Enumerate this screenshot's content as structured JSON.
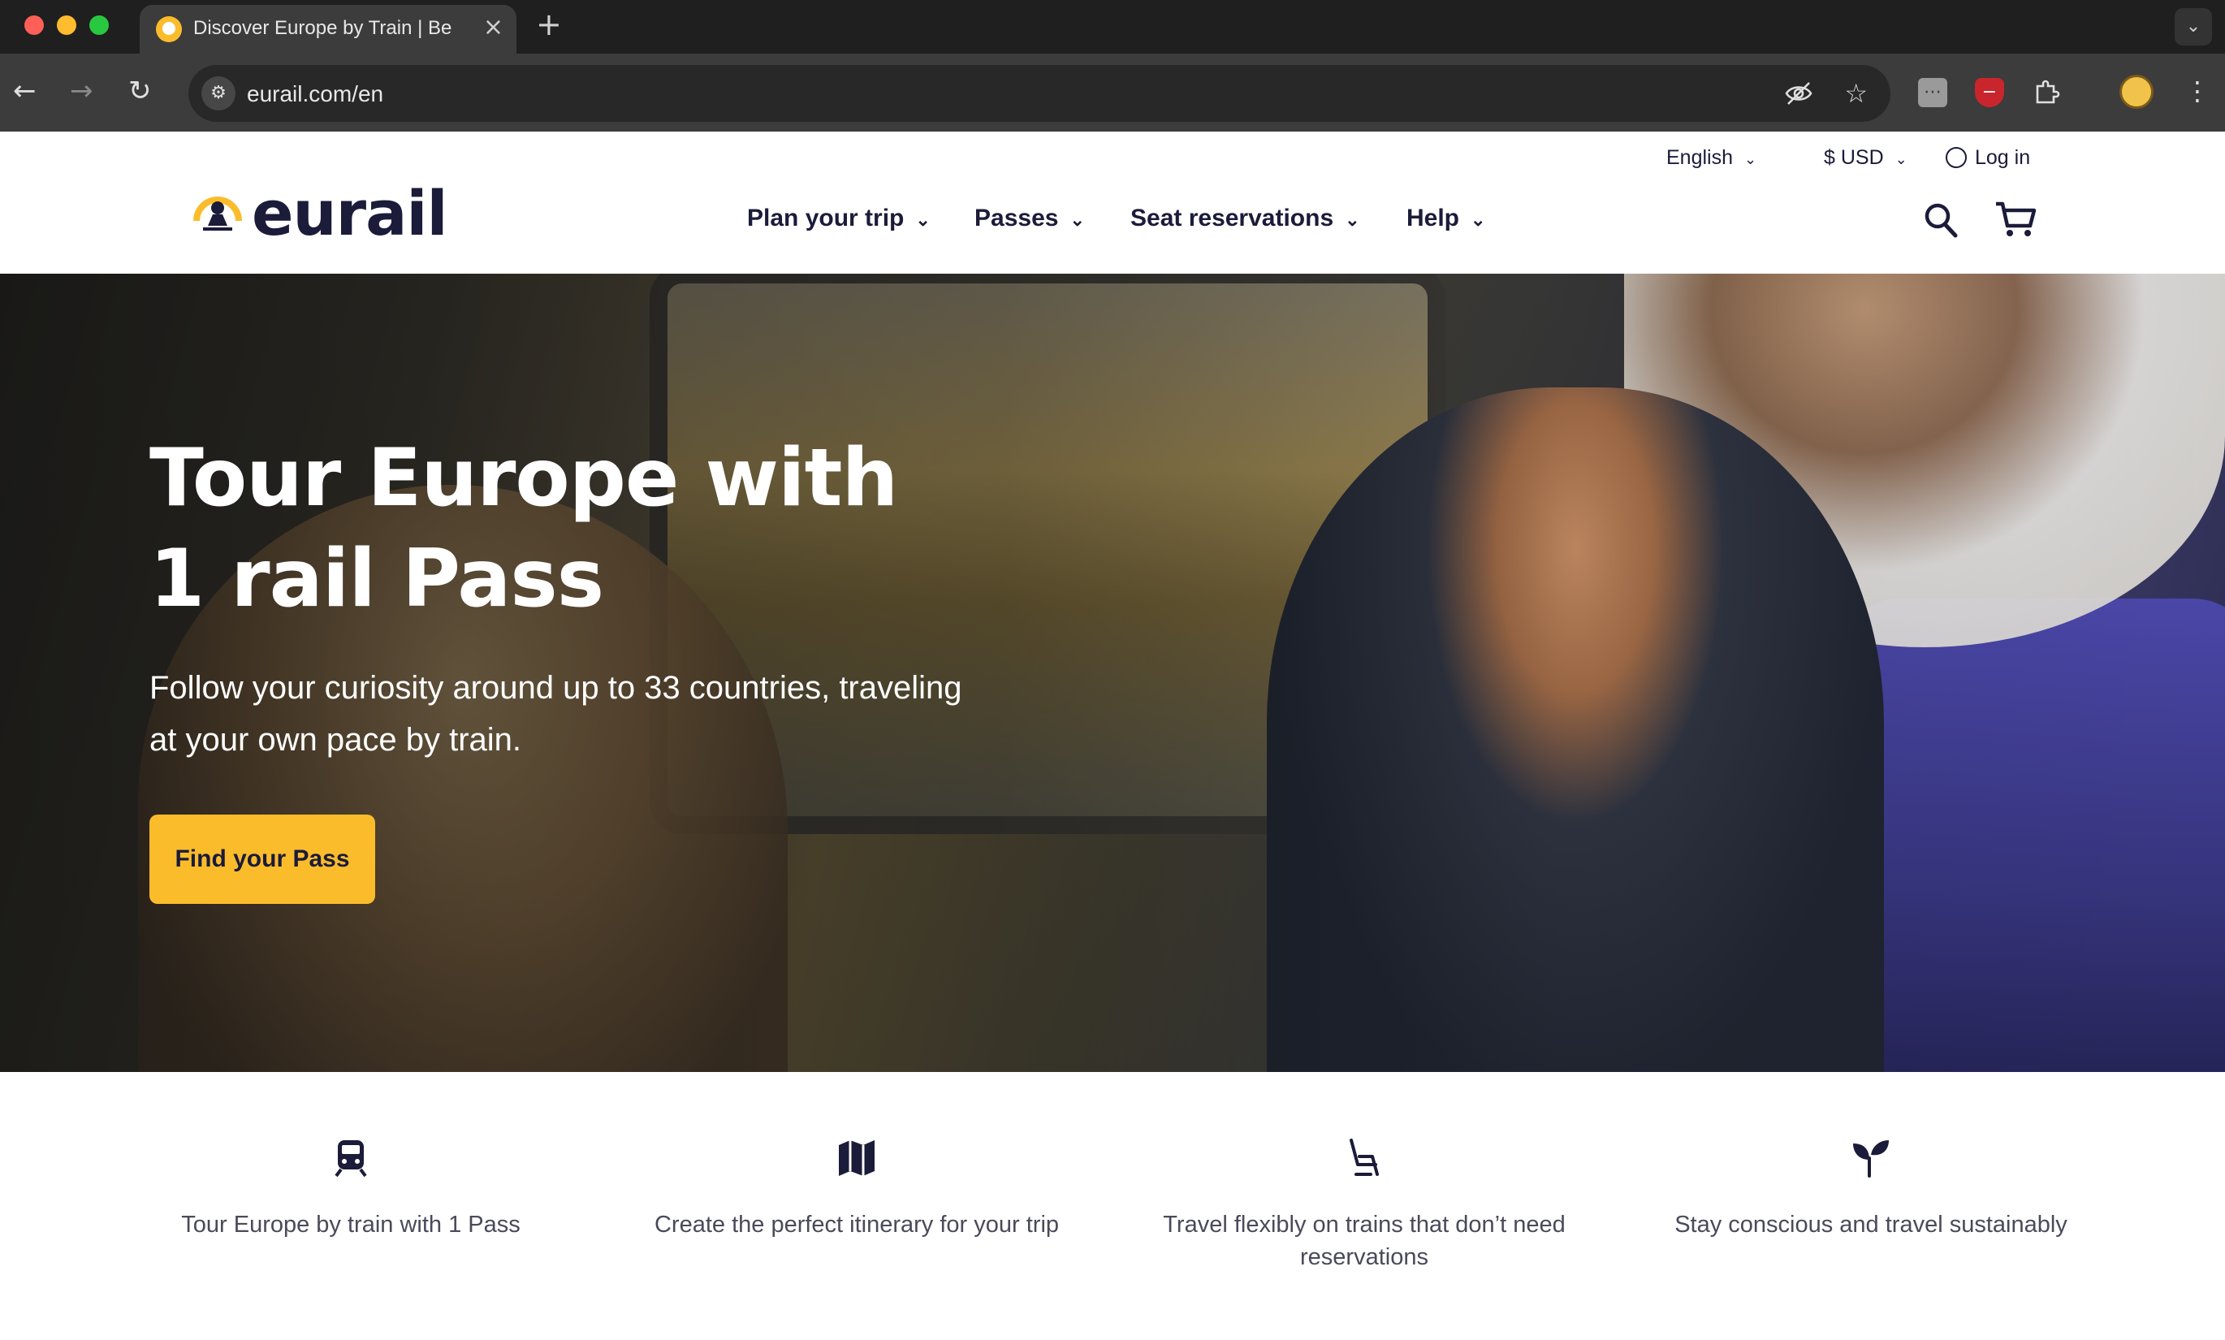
{
  "browser": {
    "tab_title": "Discover Europe by Train | Be",
    "new_tab_icon": "+",
    "close_icon": "×",
    "url": "eurail.com/en"
  },
  "header": {
    "logo_text": "eurail",
    "language": "English",
    "currency": "$ USD",
    "login": "Log in",
    "nav": {
      "plan": "Plan your trip",
      "passes": "Passes",
      "seats": "Seat reservations",
      "help": "Help"
    }
  },
  "hero": {
    "title": "Tour Europe with 1 rail Pass",
    "subtitle": "Follow your curiosity around up to 33 countries, traveling at your own pace by train.",
    "cta": "Find your Pass"
  },
  "features": [
    {
      "icon": "train-icon",
      "text": "Tour Europe by train with 1 Pass"
    },
    {
      "icon": "map-icon",
      "text": "Create the perfect itinerary for your trip"
    },
    {
      "icon": "seat-icon",
      "text": "Travel flexibly on trains that don’t need reservations"
    },
    {
      "icon": "sprout-icon",
      "text": "Stay conscious and travel sustainably"
    }
  ],
  "colors": {
    "brand_yellow": "#fbbc2c",
    "brand_navy": "#1b1b3a",
    "chrome_dark": "#1f1f1f",
    "chrome_toolbar": "#3c3c3c"
  }
}
